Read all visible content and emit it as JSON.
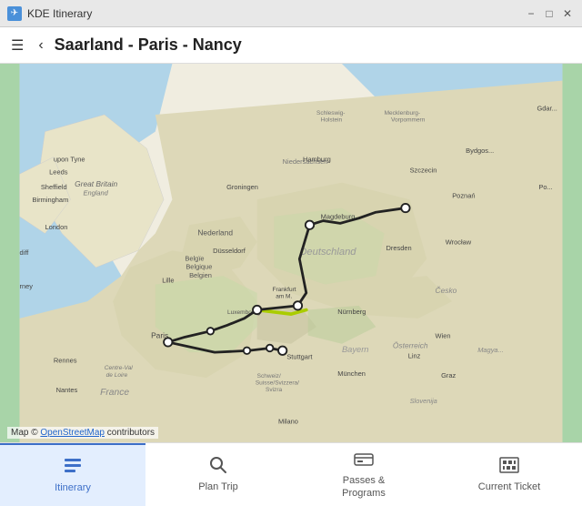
{
  "window": {
    "title": "KDE Itinerary",
    "app_icon": "✈"
  },
  "title_controls": {
    "minimize": "−",
    "maximize": "□",
    "close": "✕"
  },
  "header": {
    "menu_icon": "☰",
    "back_icon": "‹",
    "title": "Saarland - Paris - Nancy"
  },
  "map": {
    "attribution_prefix": "Map ©",
    "attribution_link_text": "OpenStreetMap",
    "attribution_suffix": " contributors"
  },
  "nav_items": [
    {
      "id": "itinerary",
      "label": "Itinerary",
      "icon": "≡",
      "active": true
    },
    {
      "id": "plan-trip",
      "label": "Plan Trip",
      "icon": "🔍",
      "active": false
    },
    {
      "id": "passes-programs",
      "label": "Passes &\nPrograms",
      "icon": "🎟",
      "active": false
    },
    {
      "id": "current-ticket",
      "label": "Current Ticket",
      "icon": "▦",
      "active": false
    }
  ]
}
